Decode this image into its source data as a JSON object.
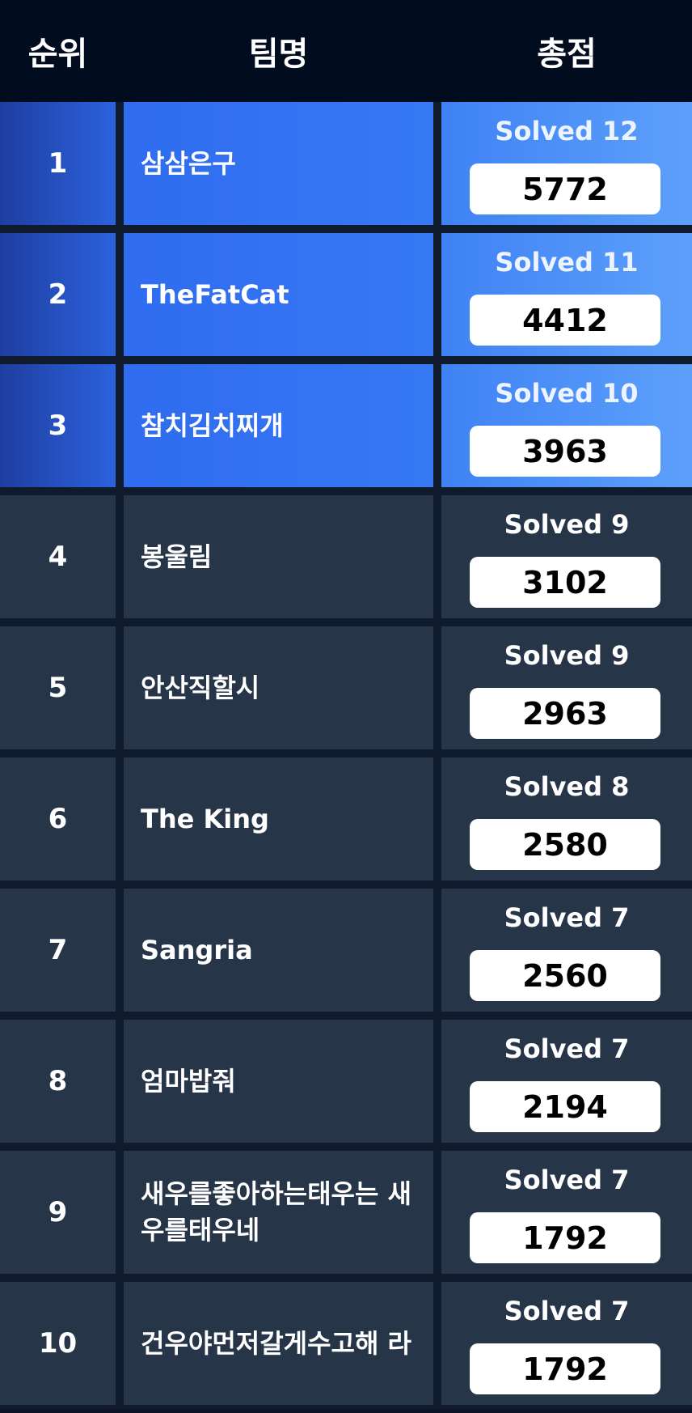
{
  "header": {
    "rank_label": "순위",
    "team_label": "팀명",
    "score_label": "총점"
  },
  "colors": {
    "header_bg": "#020c1f",
    "row_bg": "#273548",
    "highlight_blue": "#3778f3",
    "points_box": "#ffffff"
  },
  "rows": [
    {
      "rank": "1",
      "team": "삼삼은구",
      "solved": "Solved 12",
      "points": "5772",
      "highlight": true
    },
    {
      "rank": "2",
      "team": "TheFatCat",
      "solved": "Solved 11",
      "points": "4412",
      "highlight": true
    },
    {
      "rank": "3",
      "team": "참치김치찌개",
      "solved": "Solved 10",
      "points": "3963",
      "highlight": true
    },
    {
      "rank": "4",
      "team": "봉울림",
      "solved": "Solved 9",
      "points": "3102",
      "highlight": false
    },
    {
      "rank": "5",
      "team": "안산직할시",
      "solved": "Solved 9",
      "points": "2963",
      "highlight": false
    },
    {
      "rank": "6",
      "team": "The King",
      "solved": "Solved 8",
      "points": "2580",
      "highlight": false
    },
    {
      "rank": "7",
      "team": "Sangria",
      "solved": "Solved 7",
      "points": "2560",
      "highlight": false
    },
    {
      "rank": "8",
      "team": "엄마밥줘",
      "solved": "Solved 7",
      "points": "2194",
      "highlight": false
    },
    {
      "rank": "9",
      "team": "새우를좋아하는태우는 새우를태우네",
      "solved": "Solved 7",
      "points": "1792",
      "highlight": false
    },
    {
      "rank": "10",
      "team": "건우야먼저갈게수고해 라",
      "solved": "Solved 7",
      "points": "1792",
      "highlight": false
    }
  ]
}
